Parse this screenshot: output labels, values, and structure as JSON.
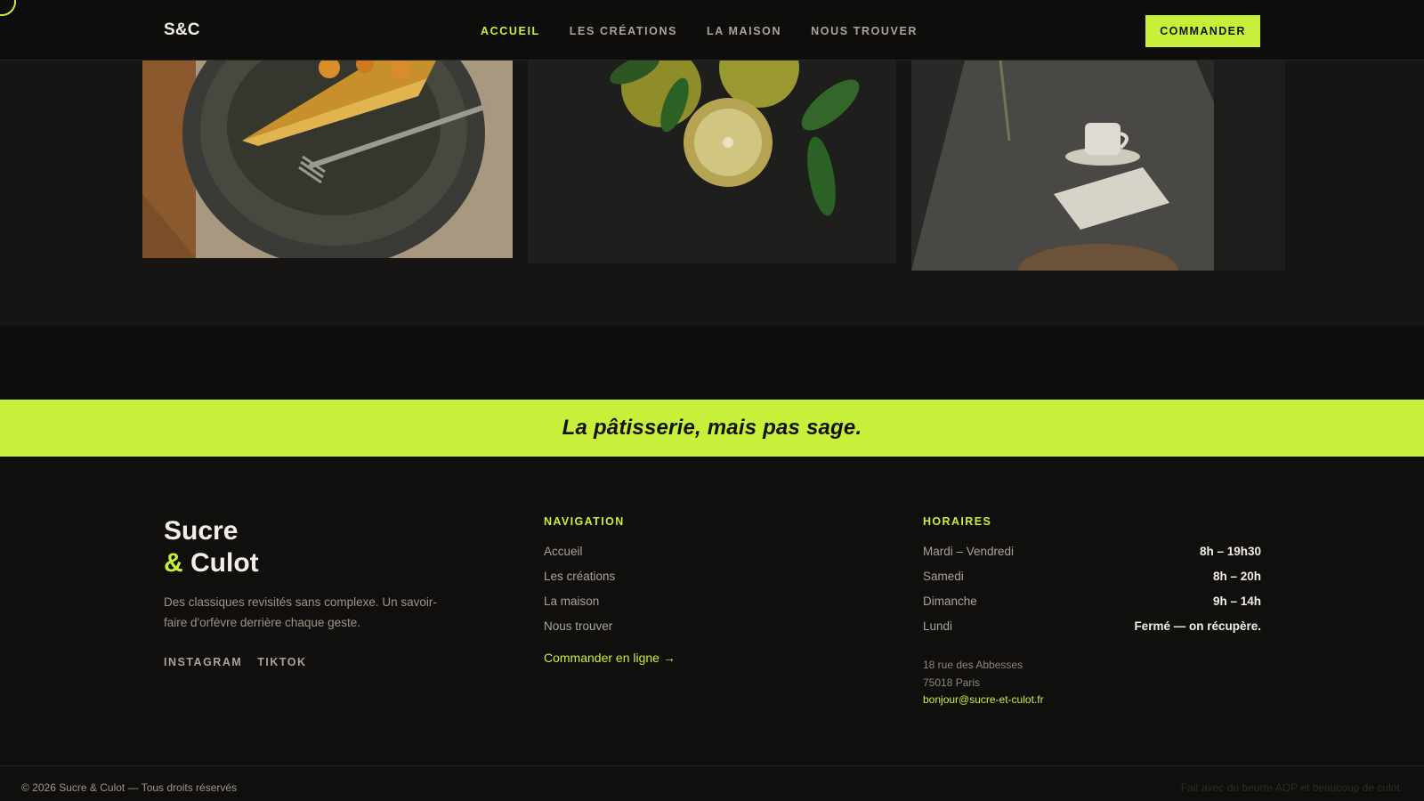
{
  "header": {
    "logo": "S&C",
    "nav": [
      "ACCUEIL",
      "LES CRÉATIONS",
      "LA MAISON",
      "NOUS TROUVER"
    ],
    "active_nav": "ACCUEIL",
    "cta": "COMMANDER"
  },
  "gallery": {
    "photos": [
      "tart-slice-photo",
      "lemons-photo",
      "cafe-table-photo"
    ]
  },
  "tagline": "La pâtisserie, mais pas sage.",
  "footer": {
    "brand_line1": "Sucre",
    "brand_amp": "&",
    "brand_line2": "Culot",
    "description": "Des classiques revisités sans complexe. Un savoir-faire d'orfèvre derrière chaque geste.",
    "socials": [
      "INSTAGRAM",
      "TIKTOK"
    ],
    "navigation": {
      "title": "NAVIGATION",
      "items": [
        "Accueil",
        "Les créations",
        "La maison",
        "Nous trouver"
      ],
      "cta": "Commander en ligne →"
    },
    "hours": {
      "title": "HORAIRES",
      "rows": [
        {
          "day": "Mardi – Vendredi",
          "time": "8h – 19h30"
        },
        {
          "day": "Samedi",
          "time": "8h – 20h"
        },
        {
          "day": "Dimanche",
          "time": "9h – 14h"
        },
        {
          "day": "Lundi",
          "time": "Fermé — on récupère."
        }
      ]
    },
    "address": {
      "street": "18 rue des Abbesses",
      "city": "75018 Paris",
      "email": "bonjour@sucre-et-culot.fr"
    },
    "copyright": "© 2026 Sucre & Culot — Tous droits réservés",
    "made_with": "Fait avec du beurre AOP et beaucoup de culot."
  },
  "colors": {
    "accent": "#c8ef3a",
    "background": "#141210",
    "text": "#f2efe6"
  }
}
